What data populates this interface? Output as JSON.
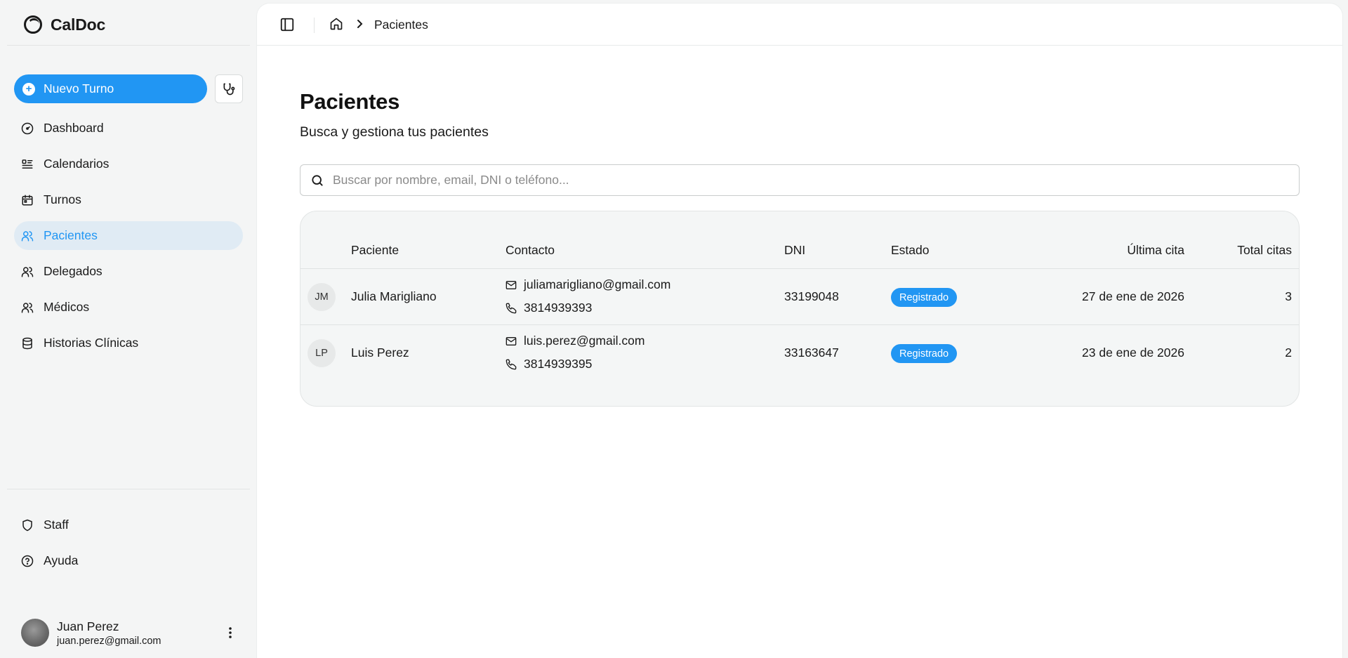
{
  "app": {
    "name": "CalDoc"
  },
  "sidebar": {
    "new_button_label": "Nuevo Turno",
    "items": [
      {
        "label": "Dashboard",
        "icon": "gauge-icon"
      },
      {
        "label": "Calendarios",
        "icon": "list-calendar-icon"
      },
      {
        "label": "Turnos",
        "icon": "calendar-icon"
      },
      {
        "label": "Pacientes",
        "icon": "users-icon",
        "active": true
      },
      {
        "label": "Delegados",
        "icon": "users-icon"
      },
      {
        "label": "Médicos",
        "icon": "users-icon"
      },
      {
        "label": "Historias Clínicas",
        "icon": "database-icon"
      }
    ],
    "bottom_items": [
      {
        "label": "Staff",
        "icon": "shield-icon"
      },
      {
        "label": "Ayuda",
        "icon": "help-circle-icon"
      }
    ],
    "user": {
      "name": "Juan Perez",
      "email": "juan.perez@gmail.com"
    }
  },
  "header": {
    "breadcrumb_current": "Pacientes"
  },
  "main": {
    "title": "Pacientes",
    "subtitle": "Busca y gestiona tus pacientes",
    "search_placeholder": "Buscar por nombre, email, DNI o teléfono...",
    "search_value": ""
  },
  "table": {
    "columns": [
      "Paciente",
      "Contacto",
      "DNI",
      "Estado",
      "Última cita",
      "Total citas"
    ],
    "rows": [
      {
        "initials": "JM",
        "name": "Julia Marigliano",
        "email": "juliamarigliano@gmail.com",
        "phone": "3814939393",
        "dni": "33199048",
        "status": "Registrado",
        "last": "27 de ene de 2026",
        "total": "3"
      },
      {
        "initials": "LP",
        "name": "Luis Perez",
        "email": "luis.perez@gmail.com",
        "phone": "3814939395",
        "dni": "33163647",
        "status": "Registrado",
        "last": "23 de ene de 2026",
        "total": "2"
      }
    ]
  },
  "colors": {
    "accent": "#2196f3",
    "active_bg": "#e0ebf4",
    "sidebar_bg": "#f4f5f5"
  }
}
